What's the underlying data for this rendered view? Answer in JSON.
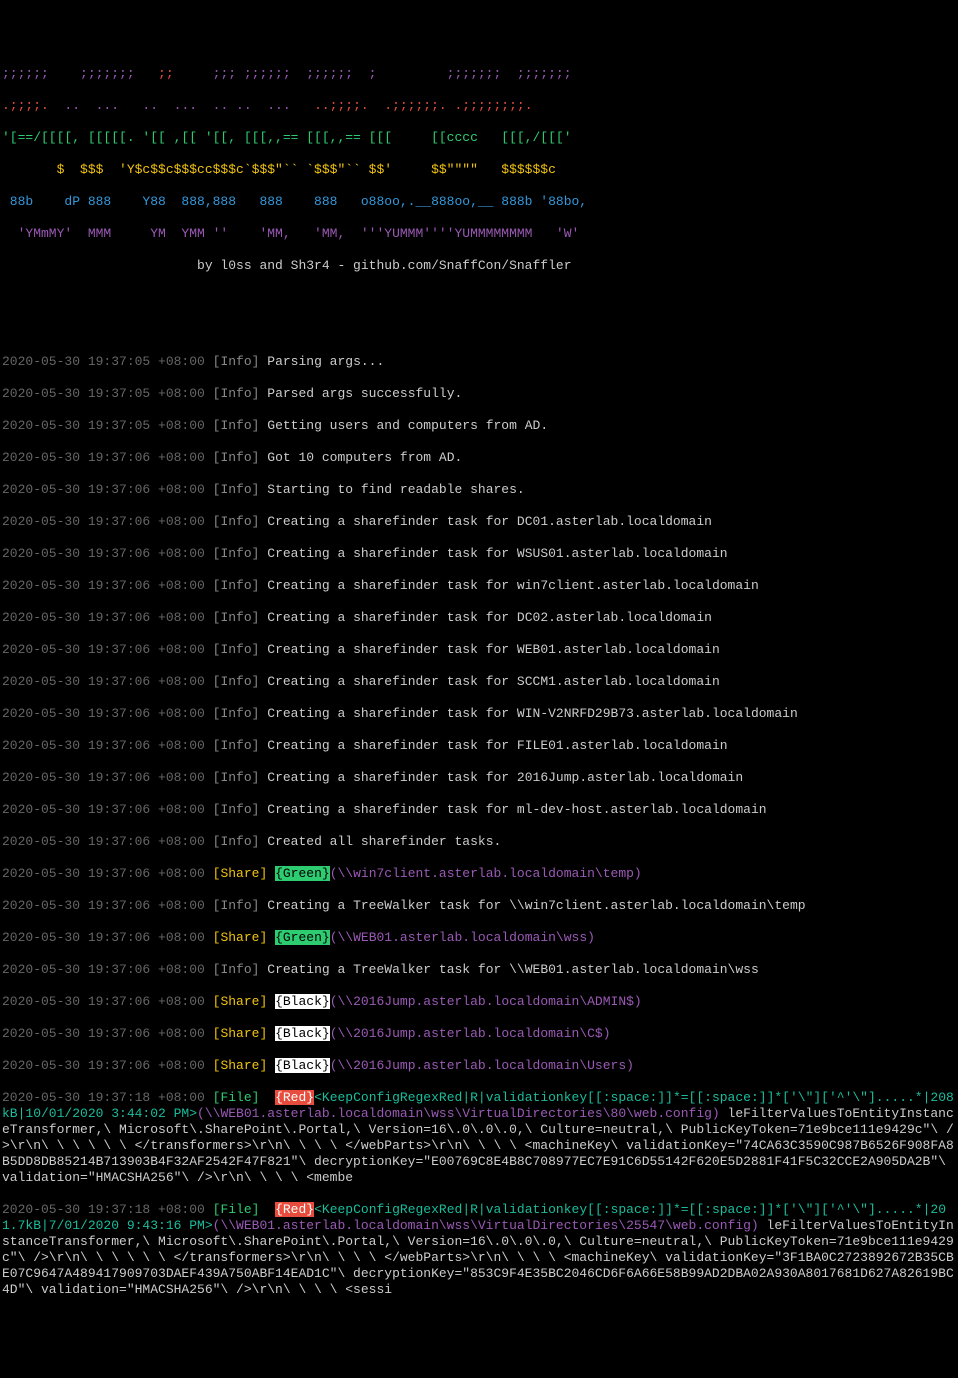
{
  "banner": {
    "l1": {
      "a": ";;;;;;    ;;;;;;;   ",
      "b": ";;     ",
      "c": ";;; ;;;;;;  ;;;;;;  ;         ;;;;;;;  ;;;;;;;"
    },
    "l2": {
      "a": ".;;;;.  ",
      "b": "..  ...   ..  ...  .. ..  ...   ",
      "c": "..;;;;.  .;;;;;;. .;;;;;;;;."
    },
    "l3": "'[==/[[[[, [[[[[. '[[ ,[[ '[[, [[[,,== [[[,,== [[[     [[cccc   [[[,/[[['",
    "l4": "       $  $$$  'Y$c$$c$$$cc$$$c`$$$\"`` `$$$\"`` $$'     $$\"\"\"\"   $$$$$$c",
    "l5": " 88b    dP 888    Y88  888,888   888    888   o88oo,.__888oo,__ 888b '88bo,",
    "l6": "  'YMmMY'  MMM     YM  YMM ''    'MM,   'MM,  '''YUMMM''''YUMMMMMMMM   'W'",
    "byline": "                         by l0ss and Sh3r4 - github.com/SnaffCon/Snaffler"
  },
  "ts": [
    "2020-05-30 19:37:05 +08:00",
    "2020-05-30 19:37:05 +08:00",
    "2020-05-30 19:37:05 +08:00",
    "2020-05-30 19:37:06 +08:00",
    "2020-05-30 19:37:06 +08:00",
    "2020-05-30 19:37:06 +08:00",
    "2020-05-30 19:37:06 +08:00",
    "2020-05-30 19:37:06 +08:00",
    "2020-05-30 19:37:06 +08:00",
    "2020-05-30 19:37:06 +08:00",
    "2020-05-30 19:37:06 +08:00",
    "2020-05-30 19:37:06 +08:00",
    "2020-05-30 19:37:06 +08:00",
    "2020-05-30 19:37:06 +08:00",
    "2020-05-30 19:37:06 +08:00",
    "2020-05-30 19:37:06 +08:00",
    "2020-05-30 19:37:06 +08:00",
    "2020-05-30 19:37:06 +08:00",
    "2020-05-30 19:37:06 +08:00",
    "2020-05-30 19:37:06 +08:00",
    "2020-05-30 19:37:06 +08:00",
    "2020-05-30 19:37:06 +08:00",
    "2020-05-30 19:37:06 +08:00",
    "2020-05-30 19:37:18 +08:00",
    "2020-05-30 19:37:18 +08:00"
  ],
  "info": "[Info]",
  "share": "[Share]",
  "file": "[File]",
  "msgs": {
    "m0": " Parsing args...",
    "m1": " Parsed args successfully.",
    "m2": " Getting users and computers from AD.",
    "m3": " Got 10 computers from AD.",
    "m4": " Starting to find readable shares.",
    "m5": " Creating a sharefinder task for DC01.asterlab.localdomain",
    "m6": " Creating a sharefinder task for WSUS01.asterlab.localdomain",
    "m7": " Creating a sharefinder task for win7client.asterlab.localdomain",
    "m8": " Creating a sharefinder task for DC02.asterlab.localdomain",
    "m9": " Creating a sharefinder task for WEB01.asterlab.localdomain",
    "m10": " Creating a sharefinder task for SCCM1.asterlab.localdomain",
    "m11": " Creating a sharefinder task for WIN-V2NRFD29B73.asterlab.localdomain",
    "m12": " Creating a sharefinder task for FILE01.asterlab.localdomain",
    "m13": " Creating a sharefinder task for 2016Jump.asterlab.localdomain",
    "m14": " Creating a sharefinder task for ml-dev-host.asterlab.localdomain",
    "m15": " Created all sharefinder tasks.",
    "m17": " Creating a TreeWalker task for \\\\win7client.asterlab.localdomain\\temp",
    "m19": " Creating a TreeWalker task for \\\\WEB01.asterlab.localdomain\\wss"
  },
  "tags": {
    "green": "{Green}",
    "black": "{Black}",
    "red": "{Red}"
  },
  "paths": {
    "p1": "(\\\\win7client.asterlab.localdomain\\temp)",
    "p2": "(\\\\WEB01.asterlab.localdomain\\wss)",
    "p3": "(\\\\2016Jump.asterlab.localdomain\\ADMIN$)",
    "p4": "(\\\\2016Jump.asterlab.localdomain\\C$)",
    "p5": "(\\\\2016Jump.asterlab.localdomain\\Users)"
  },
  "regex": "<KeepConfigRegexRed|R|validationkey[[:space:]]*=[[:space:]]*['\\\"]['^'\\\"].....*|",
  "fileDetail1": {
    "meta": "208kB|10/01/2020 3:44:02 PM>",
    "path": "(\\\\WEB01.asterlab.localdomain\\wss\\VirtualDirectories\\80\\web.config)",
    "body": " leFilterValuesToEntityInstanceTransformer,\\ Microsoft\\.SharePoint\\.Portal,\\ Version=16\\.0\\.0\\.0,\\ Culture=neutral,\\ PublicKeyToken=71e9bce111e9429c\"\\ />\\r\\n\\ \\ \\ \\ \\ \\ </transformers>\\r\\n\\ \\ \\ \\ </webParts>\\r\\n\\ \\ \\ \\ <machineKey\\ validationKey=\"74CA63C3590C987B6526F908FA8B5DD8DB85214B713903B4F32AF2542F47F821\"\\ decryptionKey=\"E00769C8E4B8C708977EC7E91C6D55142F620E5D2881F41F5C32CCE2A905DA2B\"\\ validation=\"HMACSHA256\"\\ />\\r\\n\\ \\ \\ \\ <membe"
  },
  "fileDetail2": {
    "meta": "201.7kB|7/01/2020 9:43:16 PM>",
    "path": "(\\\\WEB01.asterlab.localdomain\\wss\\VirtualDirectories\\25547\\web.config)",
    "body": " leFilterValuesToEntityInstanceTransformer,\\ Microsoft\\.SharePoint\\.Portal,\\ Version=16\\.0\\.0\\.0,\\ Culture=neutral,\\ PublicKeyToken=71e9bce111e9429c\"\\ />\\r\\n\\ \\ \\ \\ \\ \\ </transformers>\\r\\n\\ \\ \\ \\ </webParts>\\r\\n\\ \\ \\ \\ <machineKey\\ validationKey=\"3F1BA0C2723892672B35CBE07C9647A489417909703DAEF439A750ABF14EAD1C\"\\ decryptionKey=\"853C9F4E35BC2046CD6F6A66E58B99AD2DBA02A930A8017681D627A82619BC4D\"\\ validation=\"HMACSHA256\"\\ />\\r\\n\\ \\ \\ \\ <sessi"
  }
}
